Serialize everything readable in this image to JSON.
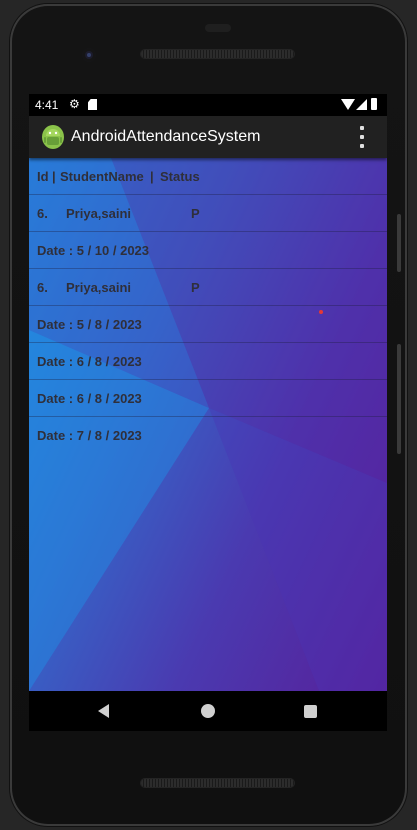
{
  "status_bar": {
    "time": "4:41",
    "icons": [
      "gear-icon",
      "sd-card-icon",
      "wifi-icon",
      "signal-icon",
      "battery-icon"
    ]
  },
  "app_bar": {
    "title": "AndroidAttendanceSystem",
    "icons": [
      "android-icon",
      "overflow-menu-icon"
    ],
    "background": "#212121"
  },
  "list": {
    "header": {
      "id": "Id",
      "sep1": "|",
      "name": "StudentName",
      "sep2": "|",
      "status": "Status"
    },
    "rows": [
      {
        "id": "6.",
        "name": "Priya,saini",
        "status": "P"
      },
      {
        "date": "Date : 5 / 10 / 2023"
      },
      {
        "id": "6.",
        "name": "Priya,saini",
        "status": "P"
      },
      {
        "date": "Date : 5 / 8 / 2023"
      },
      {
        "date": "Date : 6 / 8 / 2023"
      },
      {
        "date": "Date : 6 / 8 / 2023"
      },
      {
        "date": "Date : 7 / 8 / 2023"
      }
    ]
  },
  "colors": {
    "gradient_start": "#1f8de0",
    "gradient_end": "#581f99",
    "text": "#2f2f3a",
    "marker": "#e53935"
  },
  "nav_bar": {
    "icons": [
      "back-icon",
      "home-icon",
      "recents-icon"
    ]
  }
}
